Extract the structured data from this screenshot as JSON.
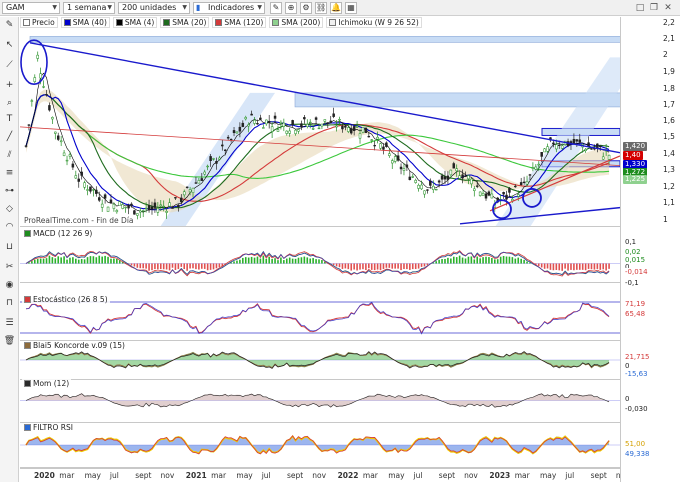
{
  "toolbar": {
    "symbol": "GAM",
    "timeframe": "1 semana",
    "units": "200 unidades",
    "indicators_label": "Indicadores"
  },
  "legend": [
    {
      "name": "price",
      "label": "Precio",
      "color": "#ffffff"
    },
    {
      "name": "sma40",
      "label": "SMA (40)",
      "color": "#0000cc"
    },
    {
      "name": "sma4",
      "label": "SMA (4)",
      "color": "#000000"
    },
    {
      "name": "sma20",
      "label": "SMA (20)",
      "color": "#1e6b1e"
    },
    {
      "name": "sma120",
      "label": "SMA (120)",
      "color": "#d43a3a"
    },
    {
      "name": "sma200",
      "label": "SMA (200)",
      "color": "#8fd18f"
    },
    {
      "name": "ichimoku",
      "label": "Ichimoku (W 9 26 52)",
      "color": "#f0f0f0"
    }
  ],
  "watermark": "ProRealTime.com - Fin de Día",
  "panels": {
    "macd": {
      "title": "MACD (12 26 9)",
      "color": "#1e8c1e"
    },
    "stoch": {
      "title": "Estocástico (26 8 5)",
      "color": "#d43a3a"
    },
    "blai5": {
      "title": "Blai5 Koncorde v.09 (15)",
      "color": "#8c6a3a"
    },
    "mom": {
      "title": "Mom (12)",
      "color": "#2a2a2a"
    },
    "rsi": {
      "title": "FILTRO RSI",
      "color": "#2a6ad4"
    }
  },
  "price_axis": {
    "ticks": [
      "2,2",
      "2,1",
      "2",
      "1,9",
      "1,8",
      "1,7",
      "1,6",
      "1,5",
      "1,4",
      "1,3",
      "1,2",
      "1,1",
      "1"
    ],
    "tags": [
      {
        "text": "1,420",
        "color": "#6b6b6b"
      },
      {
        "text": "1,40",
        "color": "#d40000"
      },
      {
        "text": "1,330",
        "color": "#0000cc"
      },
      {
        "text": "1,272",
        "color": "#1e8c1e"
      },
      {
        "text": "1,225",
        "color": "#8fd18f"
      }
    ]
  },
  "indicator_axis": {
    "macd": [
      "0,1",
      "0,02",
      "0,015",
      "0",
      "-0,014",
      "-0,1"
    ],
    "stoch": [
      "71,19",
      "65,48"
    ],
    "blai5": [
      "21,715",
      "0",
      "-15,63"
    ],
    "mom": [
      "0",
      "-0,030"
    ],
    "rsi": [
      "51,00",
      "49,338"
    ]
  },
  "time_axis": [
    {
      "text": "2020",
      "year": true
    },
    {
      "text": "mar",
      "year": false
    },
    {
      "text": "may",
      "year": false
    },
    {
      "text": "jul",
      "year": false
    },
    {
      "text": "sept",
      "year": false
    },
    {
      "text": "nov",
      "year": false
    },
    {
      "text": "2021",
      "year": true
    },
    {
      "text": "mar",
      "year": false
    },
    {
      "text": "may",
      "year": false
    },
    {
      "text": "jul",
      "year": false
    },
    {
      "text": "sept",
      "year": false
    },
    {
      "text": "nov",
      "year": false
    },
    {
      "text": "2022",
      "year": true
    },
    {
      "text": "mar",
      "year": false
    },
    {
      "text": "may",
      "year": false
    },
    {
      "text": "jul",
      "year": false
    },
    {
      "text": "sept",
      "year": false
    },
    {
      "text": "nov",
      "year": false
    },
    {
      "text": "2023",
      "year": true
    },
    {
      "text": "mar",
      "year": false
    },
    {
      "text": "may",
      "year": false
    },
    {
      "text": "jul",
      "year": false
    },
    {
      "text": "sept",
      "year": false
    },
    {
      "text": "nov",
      "year": false
    }
  ],
  "colors": {
    "trendline": "#1a1acc",
    "zone_fill": "#c8dcf5",
    "cloud_green": "#c8f0c8",
    "cloud_tan": "#e8d8b8",
    "candle_up": "#1e8c1e",
    "candle_down": "#222222"
  }
}
